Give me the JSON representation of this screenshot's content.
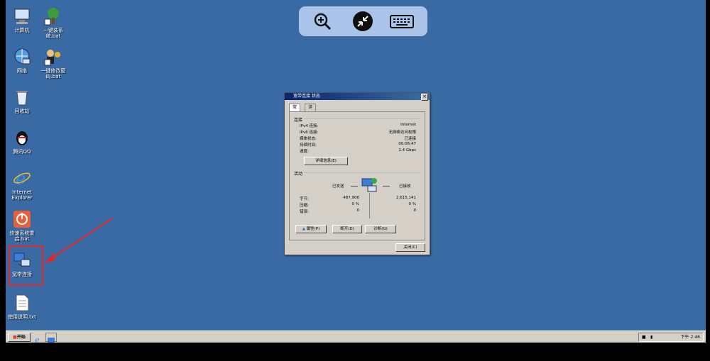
{
  "desktop": {
    "icons": [
      {
        "label": "计算机",
        "icon": "computer-icon"
      },
      {
        "label": "一键装系统.bat",
        "icon": "tree-icon"
      },
      {
        "label": "网络",
        "icon": "network-icon"
      },
      {
        "label": "一键修改密码.bat",
        "icon": "users-key-icon"
      },
      {
        "label": "回收站",
        "icon": "recycle-bin-icon"
      },
      {
        "label": "腾讯QQ",
        "icon": "qq-penguin-icon"
      },
      {
        "label": "Internet Explorer",
        "icon": "ie-icon"
      },
      {
        "label": "快速系统重启.bat",
        "icon": "power-icon"
      },
      {
        "label": "宽带连接",
        "icon": "broadband-connection-icon"
      },
      {
        "label": "使用说明.txt",
        "icon": "text-file-icon"
      }
    ]
  },
  "remote_toolbar": {
    "buttons": [
      "zoom-in-icon",
      "collapse-arrows-icon",
      "keyboard-icon"
    ]
  },
  "dialog": {
    "title": "宽带连接 状态",
    "close_glyph": "×",
    "tabs": [
      "常规",
      "详细信息"
    ],
    "connection": {
      "group_label": "连接",
      "rows": [
        {
          "label": "IPv4 连接:",
          "value": "Internet"
        },
        {
          "label": "IPv6 连接:",
          "value": "无网络访问权限"
        },
        {
          "label": "媒体状态:",
          "value": "已连接"
        },
        {
          "label": "持续时间:",
          "value": "00:06:47"
        },
        {
          "label": "速度:",
          "value": "1.4 Gbps"
        }
      ],
      "details_button": "详细信息(E)"
    },
    "activity": {
      "group_label": "活动",
      "sent_label": "已发送",
      "received_label": "已接收",
      "rows": [
        {
          "label": "字节:",
          "sent": "487,906",
          "received": "2,615,141"
        },
        {
          "label": "压缩:",
          "sent": "0 %",
          "received": "0 %"
        },
        {
          "label": "错误:",
          "sent": "0",
          "received": "0"
        }
      ]
    },
    "buttons": {
      "properties": "属性(P)",
      "disconnect": "断开(D)",
      "diagnose": "诊断(G)",
      "close": "关闭(C)"
    }
  },
  "taskbar": {
    "start_label": "开始",
    "clock": "下午 2:46"
  },
  "colors": {
    "desktop_bg": "#3a6aa4",
    "annotation": "#e4262a"
  }
}
